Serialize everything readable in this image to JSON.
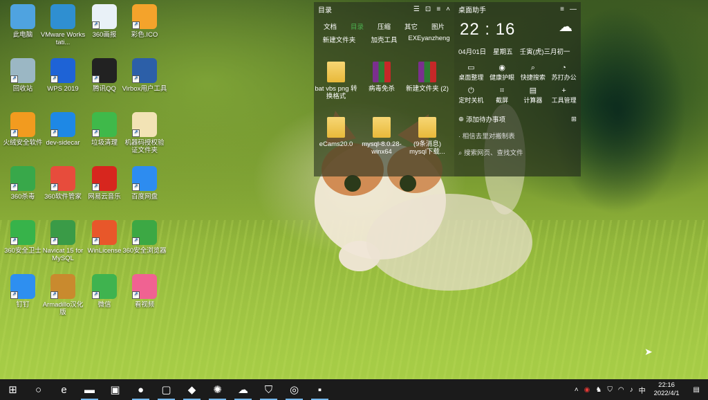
{
  "desktop_icons": [
    {
      "label": "此电脑",
      "icon": "computer-icon",
      "color": "#4fa3e0"
    },
    {
      "label": "VMware Workstati...",
      "icon": "vmware-icon",
      "color": "#2f8fd1"
    },
    {
      "label": "360画报",
      "icon": "360-pictorial-icon",
      "color": "#e9f1f7"
    },
    {
      "label": "彩色.ICO",
      "icon": "color-ico-icon",
      "color": "#f4a32b"
    },
    {
      "label": "回收站",
      "icon": "recycle-bin-icon",
      "color": "#9bb7c4"
    },
    {
      "label": "WPS 2019",
      "icon": "wps-icon",
      "color": "#1e63d6"
    },
    {
      "label": "腾讯QQ",
      "icon": "qq-icon",
      "color": "#222222"
    },
    {
      "label": "Virbox用户工具",
      "icon": "virbox-icon",
      "color": "#2c5fa8"
    },
    {
      "label": "火绒安全软件",
      "icon": "huorong-icon",
      "color": "#f29b1f"
    },
    {
      "label": "dev-sidecar",
      "icon": "dev-sidecar-icon",
      "color": "#1e88e5"
    },
    {
      "label": "垃圾清理",
      "icon": "cleaner-icon",
      "color": "#3fb94a"
    },
    {
      "label": "机器码授权验证文件夹",
      "icon": "folder-icon",
      "color": "#f2e3b5"
    },
    {
      "label": "360杀毒",
      "icon": "360-antivirus-icon",
      "color": "#38a84a"
    },
    {
      "label": "360软件管家",
      "icon": "360-software-icon",
      "color": "#e74c3c"
    },
    {
      "label": "网易云音乐",
      "icon": "netease-music-icon",
      "color": "#d7261e"
    },
    {
      "label": "百度网盘",
      "icon": "baidu-netdisk-icon",
      "color": "#2d8cf0"
    },
    {
      "label": "360安全卫士",
      "icon": "360-guard-icon",
      "color": "#37b34a"
    },
    {
      "label": "Navicat 15 for MySQL",
      "icon": "navicat-icon",
      "color": "#3a9b47"
    },
    {
      "label": "WinLicense",
      "icon": "winlicense-icon",
      "color": "#e8572a"
    },
    {
      "label": "360安全浏览器",
      "icon": "360-browser-icon",
      "color": "#3ca844"
    },
    {
      "label": "钉钉",
      "icon": "dingtalk-icon",
      "color": "#2e8ff0"
    },
    {
      "label": "Armadillo汉化版",
      "icon": "armadillo-icon",
      "color": "#c98a2e"
    },
    {
      "label": "微信",
      "icon": "wechat-icon",
      "color": "#3fb34f"
    },
    {
      "label": "看视频",
      "icon": "video-icon",
      "color": "#f06292"
    }
  ],
  "fence": {
    "title": "目录",
    "tabs": [
      "文档",
      "目录",
      "压缩",
      "其它",
      "图片"
    ],
    "active_tab": "目录",
    "top_labels": [
      "新建文件夹",
      "加壳工具",
      "EXEyanzheng"
    ],
    "files": [
      {
        "label": "bat vbs png 转换格式",
        "type": "folder"
      },
      {
        "label": "病毒免杀",
        "type": "rar"
      },
      {
        "label": "新建文件夹 (2)",
        "type": "rar"
      },
      {
        "label": "eCams20.0",
        "type": "folder"
      },
      {
        "label": "mysql-8.0.28-winx64",
        "type": "folder"
      },
      {
        "label": "(9条消息) mysql下载...",
        "type": "folder"
      }
    ]
  },
  "assistant": {
    "title": "桌面助手",
    "time": "22 : 16",
    "date": "04月01日",
    "weekday": "星期五",
    "lunar": "壬寅(虎)三月初一",
    "tools": [
      {
        "label": "桌面整理",
        "icon": "desktop-organize-icon",
        "glyph": "▭"
      },
      {
        "label": "健康护眼",
        "icon": "eye-care-icon",
        "glyph": "◉"
      },
      {
        "label": "快捷搜索",
        "icon": "quick-search-icon",
        "glyph": "⌕"
      },
      {
        "label": "苏打办公",
        "icon": "soda-office-icon",
        "glyph": "◔"
      },
      {
        "label": "定时关机",
        "icon": "timer-shutdown-icon",
        "glyph": "⏻"
      },
      {
        "label": "截屏",
        "icon": "screenshot-icon",
        "glyph": "⌗"
      },
      {
        "label": "计算器",
        "icon": "calculator-icon",
        "glyph": "▤"
      },
      {
        "label": "工具管理",
        "icon": "tool-manage-icon",
        "glyph": "+"
      }
    ],
    "add_todo": "添加待办事项",
    "todo_item": "· 相信去里对搬制表",
    "search_placeholder": "搜索网页、查找文件"
  },
  "taskbar": {
    "apps": [
      {
        "name": "start-button",
        "glyph": "⊞"
      },
      {
        "name": "search-button",
        "glyph": "○"
      },
      {
        "name": "edge-icon",
        "glyph": "e"
      },
      {
        "name": "file-explorer-icon",
        "glyph": "▬"
      },
      {
        "name": "store-icon",
        "glyph": "▣"
      },
      {
        "name": "360-icon",
        "glyph": "●"
      },
      {
        "name": "vmware-icon",
        "glyph": "▢"
      },
      {
        "name": "notepad-icon",
        "glyph": "◆"
      },
      {
        "name": "game-icon",
        "glyph": "✺"
      },
      {
        "name": "onedrive-icon",
        "glyph": "☁"
      },
      {
        "name": "shield-icon",
        "glyph": "⛉"
      },
      {
        "name": "netease-icon",
        "glyph": "◎"
      },
      {
        "name": "app-icon",
        "glyph": "▪"
      }
    ],
    "tray": {
      "ime": "中",
      "time": "22:16",
      "date": "2022/4/1"
    }
  }
}
